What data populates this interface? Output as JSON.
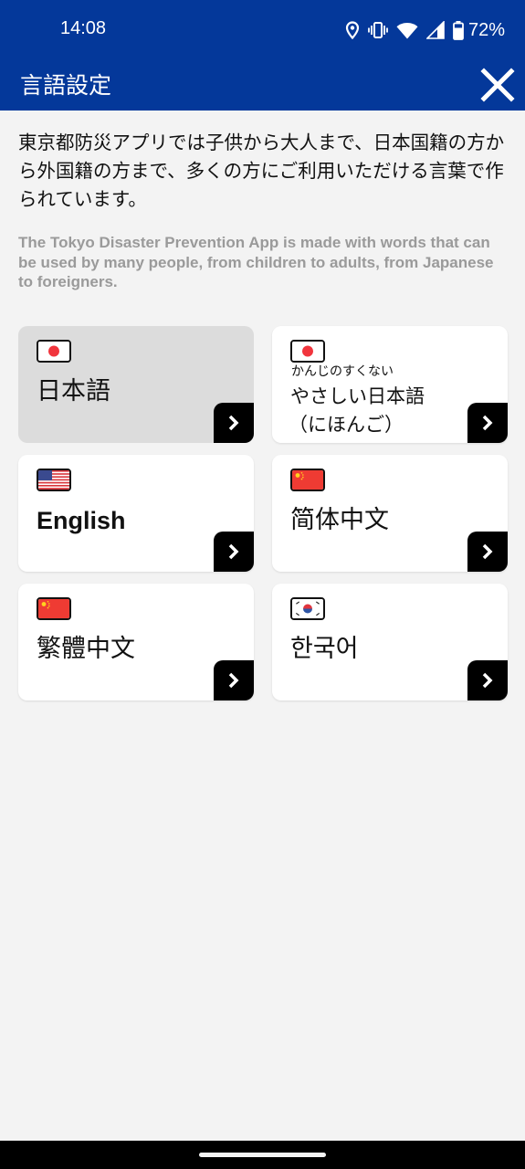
{
  "status_bar": {
    "time": "14:08",
    "battery": "72%",
    "icons": [
      "location-icon",
      "vibrate-icon",
      "wifi-icon",
      "signal-icon",
      "battery-icon"
    ]
  },
  "header": {
    "title": "言語設定",
    "close_icon": "close-icon",
    "background": "#04389a"
  },
  "intro": {
    "japanese": "東京都防災アプリでは子供から大人まで、日本国籍の方から外国籍の方まで、多くの方にご利用いただける言葉で作られています。",
    "english": "The Tokyo Disaster Prevention App is made with words that can be used by many people, from children to adults, from Japanese to foreigners."
  },
  "languages": [
    {
      "label": "日本語",
      "flag": "japan-flag-icon",
      "selected": true
    },
    {
      "ruby": "かんじのすくない",
      "line1": "やさしい日本語",
      "line2": "（にほんご）",
      "flag": "japan-flag-icon",
      "selected": false
    },
    {
      "label": "English",
      "flag": "usa-flag-icon",
      "selected": false
    },
    {
      "label": "简体中文",
      "flag": "china-flag-icon",
      "selected": false
    },
    {
      "label": "繁體中文",
      "flag": "china-flag-icon",
      "selected": false
    },
    {
      "label": "한국어",
      "flag": "korea-flag-icon",
      "selected": false
    }
  ],
  "colors": {
    "selected_card": "#dcdcdc",
    "card": "#ffffff",
    "arrow_button": "#000000",
    "page_background": "#f3f3f3"
  }
}
